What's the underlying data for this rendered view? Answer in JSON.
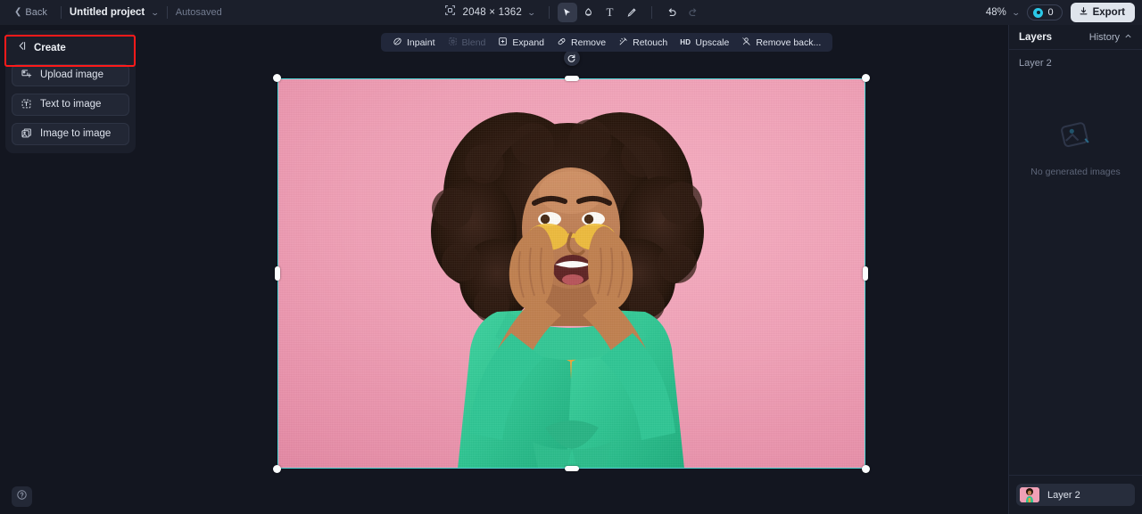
{
  "topbar": {
    "back_label": "Back",
    "project_name": "Untitled project",
    "autosaved_label": "Autosaved",
    "canvas_size": "2048 × 1362",
    "zoom_level": "48%",
    "credits_count": "0",
    "export_label": "Export",
    "icons": {
      "back_chevron": "chevron-left-icon",
      "project_caret": "chevron-down-icon",
      "resize": "resize-canvas-icon",
      "size_caret": "chevron-down-icon",
      "select": "cursor-select-icon",
      "mask": "mask-tool-icon",
      "text": "T",
      "brush": "brush-icon",
      "undo": "undo-icon",
      "redo": "redo-icon",
      "zoom_caret": "chevron-down-icon",
      "credit": "credit-coin-icon",
      "export": "download-icon"
    }
  },
  "left_panel": {
    "title": "Create",
    "collapse_icon": "collapse-panel-icon",
    "buttons": [
      {
        "label": "Upload image",
        "icon": "upload-image-icon",
        "highlighted": true
      },
      {
        "label": "Text to image",
        "icon": "text-to-image-icon",
        "highlighted": false
      },
      {
        "label": "Image to image",
        "icon": "image-to-image-icon",
        "highlighted": false
      }
    ]
  },
  "canvas_toolbar": {
    "items": [
      {
        "label": "Inpaint",
        "icon": "inpaint-icon",
        "disabled": false
      },
      {
        "label": "Blend",
        "icon": "blend-icon",
        "disabled": true
      },
      {
        "label": "Expand",
        "icon": "expand-icon",
        "disabled": false
      },
      {
        "label": "Remove",
        "icon": "eraser-icon",
        "disabled": false
      },
      {
        "label": "Retouch",
        "icon": "retouch-icon",
        "disabled": false
      },
      {
        "label": "Upscale",
        "icon": "hd-icon",
        "badge": "HD",
        "disabled": false
      },
      {
        "label": "Remove back...",
        "icon": "remove-background-icon",
        "disabled": false
      }
    ]
  },
  "canvas": {
    "rotate_icon": "rotate-icon",
    "selection_color": "#53d7d7",
    "handle_color": "#fbfdfe",
    "image_description": "Portrait of a woman with curly afro hair wearing yellow sunglasses, a green cardigan and an orange dress against a pink background"
  },
  "right_panel": {
    "title": "Layers",
    "history_label": "History",
    "history_caret_icon": "chevron-up-icon",
    "layer_group_label": "Layer 2",
    "empty_state_text": "No generated images",
    "empty_state_icon": "image-placeholder-icon",
    "layer_row": {
      "name": "Layer 2",
      "thumbnail_icon": "layer-thumbnail"
    }
  },
  "help": {
    "icon": "help-circle-icon",
    "label": "?"
  }
}
